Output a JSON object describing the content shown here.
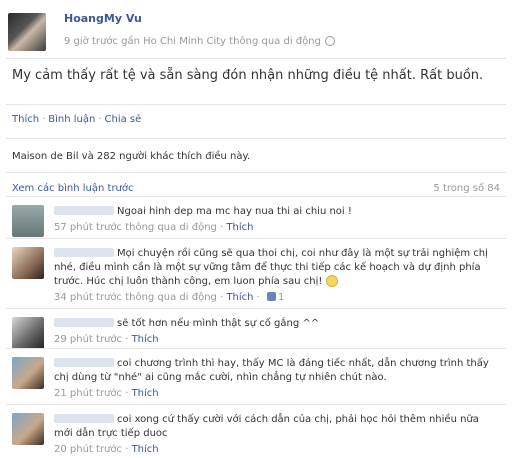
{
  "post": {
    "author": "HoangMy Vu",
    "meta": "9 giờ trước gần Ho Chi Minh City thông qua di động",
    "status": "My cảm thấy rất tệ và sẵn sàng đón nhận những điều tệ nhất. Rất buồn.",
    "actions": {
      "like": "Thích",
      "comment": "Bình luận",
      "share": "Chia sẻ"
    },
    "likes_text": "Maison de Bil và 282 người khác thích điều này.",
    "view_previous": "Xem các bình luận trước",
    "comment_count": "5 trong số 84"
  },
  "comments": [
    {
      "text": "Ngoai hinh dep ma mc hay nua thi ai chiu noi !",
      "time": "57 phút trước thông qua di động",
      "like": "Thích"
    },
    {
      "text": "Mọi chuyện rồi cũng sẽ qua thoi chị, coi như đây là một sự trải nghiệm chị nhé, điều mình cần là một sự vững tâm để thực thi tiếp các kế hoạch và dự định phía trước. Húc chị luôn thành công, em luon phía sau chị!",
      "time": "34 phút trước thông qua di động",
      "like": "Thích",
      "like_count": "1"
    },
    {
      "text": "sẽ tốt hơn nếu mình thật sự cố gắng ^^",
      "time": "29 phút trước",
      "like": "Thích"
    },
    {
      "text": "coi chương trình thì hay, thấy MC là đáng tiếc nhất, dẫn chương trình thấy chị dùng từ \"nhé\" ai cũng mắc cười, nhìn chẳng tự nhiên chút nào.",
      "time": "21 phút trước",
      "like": "Thích"
    },
    {
      "text": "coi xong cứ thấy cười với cách dẫn của chị, phải học hỏi thêm nhiều nữa mới dẫn trực tiếp duoc",
      "time": "20 phút trước",
      "like": "Thích"
    }
  ]
}
